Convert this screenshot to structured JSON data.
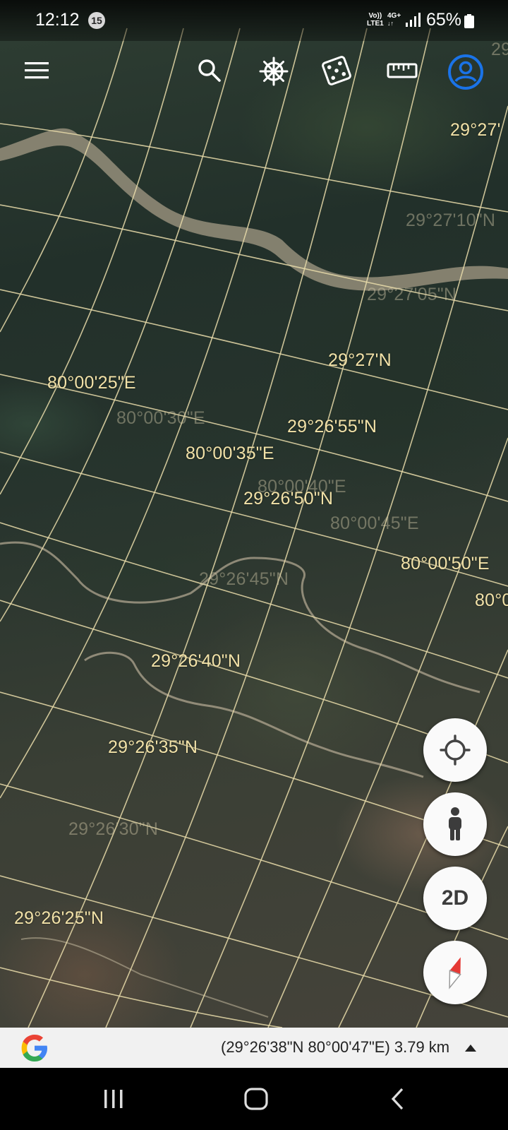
{
  "status_bar": {
    "time": "12:12",
    "notification_count": "15",
    "volte_top": "Vo))",
    "volte_bottom": "LTE1",
    "network": "4G+",
    "battery_percent": "65%"
  },
  "toolbar": {
    "icons": [
      "menu-icon",
      "search-icon",
      "voyager-wheel-icon",
      "dice-icon",
      "ruler-icon",
      "account-icon"
    ]
  },
  "grid_labels": {
    "lat_29_27_00": "29°27'N",
    "lat_29_27_corner": "29°27'",
    "lat_29_27_10": "29°27'10\"N",
    "lat_29_27_05": "29°27'05\"N",
    "lat_29_26_55": "29°26'55\"N",
    "lat_29_26_50": "29°26'50\"N",
    "lat_29_26_45": "29°26'45\"N",
    "lat_29_26_40": "29°26'40\"N",
    "lat_29_26_35": "29°26'35\"N",
    "lat_29_26_30": "29°26'30\"N",
    "lat_29_26_25": "29°26'25\"N",
    "lon_80_00_25": "80°00'25\"E",
    "lon_80_00_30": "80°00'30\"E",
    "lon_80_00_35": "80°00'35\"E",
    "lon_80_00_40": "80°00'40\"E",
    "lon_80_00_45": "80°00'45\"E",
    "lon_80_00_50": "80°00'50\"E",
    "lon_80_partial": "80°0",
    "top_right_partial": "29"
  },
  "fab": {
    "two_d_label": "2D"
  },
  "info_bar": {
    "coordinates": "(29°26'38\"N 80°00'47\"E) 3.79 km"
  },
  "colors": {
    "grid_line": "#e9dcaa",
    "label_bright": "#f2e2a8",
    "account_blue": "#1a73e8",
    "compass_red": "#e53935"
  }
}
